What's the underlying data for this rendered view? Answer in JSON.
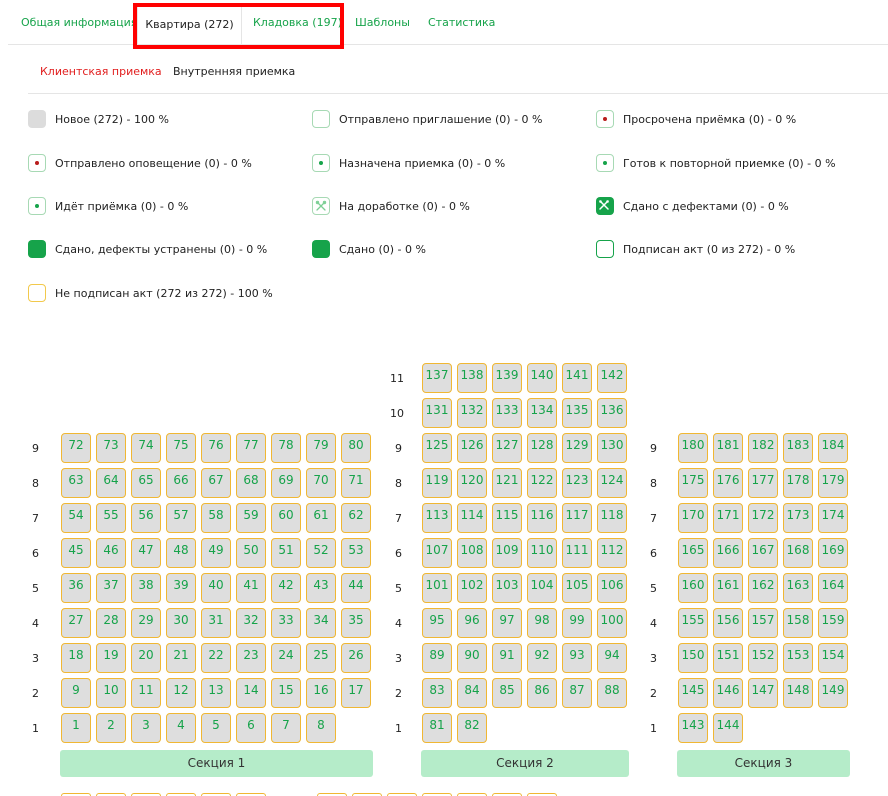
{
  "tabs": [
    {
      "label": "Общая информация",
      "active": false
    },
    {
      "label": "Квартира (272)",
      "active": true
    },
    {
      "label": "Кладовка (197)",
      "active": false
    },
    {
      "label": "Шаблоны",
      "active": false
    },
    {
      "label": "Статистика",
      "active": false
    }
  ],
  "subtabs": [
    {
      "label": "Клиентская приемка",
      "active": true
    },
    {
      "label": "Внутренняя приемка",
      "active": false
    }
  ],
  "legend": [
    {
      "label": "Новое (272) - 100 %",
      "icon": "new-status-icon"
    },
    {
      "label": "Отправлено приглашение (0) - 0 %",
      "icon": "invitation-sent-icon"
    },
    {
      "label": "Просрочена приёмка (0) - 0 %",
      "icon": "overdue-icon"
    },
    {
      "label": "Отправлено оповещение (0) - 0 %",
      "icon": "notification-sent-icon"
    },
    {
      "label": "Назначена приемка (0) - 0 %",
      "icon": "scheduled-icon"
    },
    {
      "label": "Готов к повторной приемке (0) - 0 %",
      "icon": "ready-reinspection-icon"
    },
    {
      "label": "Идёт приёмка (0) - 0 %",
      "icon": "in-progress-icon"
    },
    {
      "label": "На доработке (0) - 0 %",
      "icon": "rework-tools-icon"
    },
    {
      "label": "Сдано с дефектами (0) - 0 %",
      "icon": "defects-tools-icon"
    },
    {
      "label": "Сдано, дефекты устранены (0) - 0 %",
      "icon": "defects-fixed-icon"
    },
    {
      "label": "Сдано (0) - 0 %",
      "icon": "delivered-icon"
    },
    {
      "label": "Подписан акт (0 из 272) - 0 %",
      "icon": "act-signed-icon"
    },
    {
      "label": "Не подписан акт (272 из 272) - 100 %",
      "icon": "act-not-signed-icon"
    }
  ],
  "colors": {
    "accent": "#16a34a",
    "red_tab": "#e11d1d",
    "highlight": "#ff0000",
    "cell_bg": "#dedede",
    "cell_border": "#f0b733",
    "section_bg": "#b5ecc9",
    "dot_red": "#b91c1c"
  },
  "sections": [
    {
      "label": "Секция 1",
      "floors": [
        {
          "floor": "9",
          "units": [
            "72",
            "73",
            "74",
            "75",
            "76",
            "77",
            "78",
            "79",
            "80"
          ]
        },
        {
          "floor": "8",
          "units": [
            "63",
            "64",
            "65",
            "66",
            "67",
            "68",
            "69",
            "70",
            "71"
          ]
        },
        {
          "floor": "7",
          "units": [
            "54",
            "55",
            "56",
            "57",
            "58",
            "59",
            "60",
            "61",
            "62"
          ]
        },
        {
          "floor": "6",
          "units": [
            "45",
            "46",
            "47",
            "48",
            "49",
            "50",
            "51",
            "52",
            "53"
          ]
        },
        {
          "floor": "5",
          "units": [
            "36",
            "37",
            "38",
            "39",
            "40",
            "41",
            "42",
            "43",
            "44"
          ]
        },
        {
          "floor": "4",
          "units": [
            "27",
            "28",
            "29",
            "30",
            "31",
            "32",
            "33",
            "34",
            "35"
          ]
        },
        {
          "floor": "3",
          "units": [
            "18",
            "19",
            "20",
            "21",
            "22",
            "23",
            "24",
            "25",
            "26"
          ]
        },
        {
          "floor": "2",
          "units": [
            "9",
            "10",
            "11",
            "12",
            "13",
            "14",
            "15",
            "16",
            "17"
          ]
        },
        {
          "floor": "1",
          "units": [
            "1",
            "2",
            "3",
            "4",
            "5",
            "6",
            "7",
            "8"
          ]
        }
      ]
    },
    {
      "label": "Секция 2",
      "floors": [
        {
          "floor": "11",
          "units": [
            "137",
            "138",
            "139",
            "140",
            "141",
            "142"
          ]
        },
        {
          "floor": "10",
          "units": [
            "131",
            "132",
            "133",
            "134",
            "135",
            "136"
          ]
        },
        {
          "floor": "9",
          "units": [
            "125",
            "126",
            "127",
            "128",
            "129",
            "130"
          ]
        },
        {
          "floor": "8",
          "units": [
            "119",
            "120",
            "121",
            "122",
            "123",
            "124"
          ]
        },
        {
          "floor": "7",
          "units": [
            "113",
            "114",
            "115",
            "116",
            "117",
            "118"
          ]
        },
        {
          "floor": "6",
          "units": [
            "107",
            "108",
            "109",
            "110",
            "111",
            "112"
          ]
        },
        {
          "floor": "5",
          "units": [
            "101",
            "102",
            "103",
            "104",
            "105",
            "106"
          ]
        },
        {
          "floor": "4",
          "units": [
            "95",
            "96",
            "97",
            "98",
            "99",
            "100"
          ]
        },
        {
          "floor": "3",
          "units": [
            "89",
            "90",
            "91",
            "92",
            "93",
            "94"
          ]
        },
        {
          "floor": "2",
          "units": [
            "83",
            "84",
            "85",
            "86",
            "87",
            "88"
          ]
        },
        {
          "floor": "1",
          "units": [
            "81",
            "82"
          ]
        }
      ]
    },
    {
      "label": "Секция 3",
      "floors": [
        {
          "floor": "9",
          "units": [
            "180",
            "181",
            "182",
            "183",
            "184"
          ]
        },
        {
          "floor": "8",
          "units": [
            "175",
            "176",
            "177",
            "178",
            "179"
          ]
        },
        {
          "floor": "7",
          "units": [
            "170",
            "171",
            "172",
            "173",
            "174"
          ]
        },
        {
          "floor": "6",
          "units": [
            "165",
            "166",
            "167",
            "168",
            "169"
          ]
        },
        {
          "floor": "5",
          "units": [
            "160",
            "161",
            "162",
            "163",
            "164"
          ]
        },
        {
          "floor": "4",
          "units": [
            "155",
            "156",
            "157",
            "158",
            "159"
          ]
        },
        {
          "floor": "3",
          "units": [
            "150",
            "151",
            "152",
            "153",
            "154"
          ]
        },
        {
          "floor": "2",
          "units": [
            "145",
            "146",
            "147",
            "148",
            "149"
          ]
        },
        {
          "floor": "1",
          "units": [
            "143",
            "144"
          ]
        }
      ]
    }
  ]
}
